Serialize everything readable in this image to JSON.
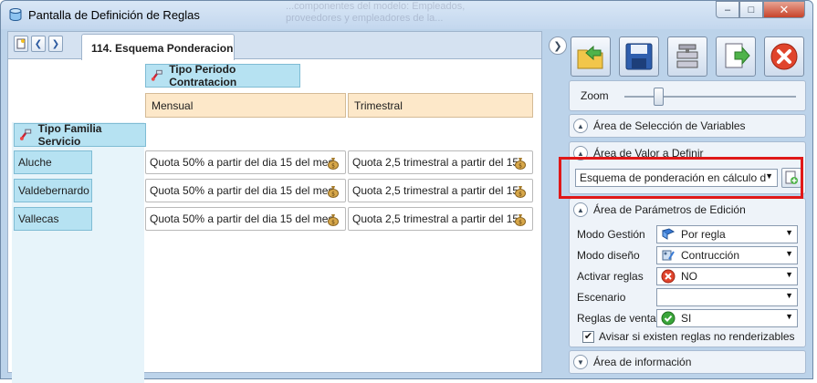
{
  "window": {
    "title": "Pantalla de Definición de Reglas",
    "ghost_text": "...componentes del modelo: Empleados, proveedores y empleadores de la...",
    "buttons": {
      "minimize": "‒",
      "maximize": "□",
      "close": "✕"
    }
  },
  "tabs": [
    {
      "label": "114. Esquema Ponderacion",
      "active": true
    }
  ],
  "pivot": {
    "column_header": "Tipo Periodo Contratacion",
    "row_header": "Tipo Familia Servicio",
    "columns": [
      "Mensual",
      "Trimestral"
    ],
    "rows": [
      {
        "label": "Aluche",
        "cells": [
          "Quota 50% a partir del dia 15 del mes",
          "Quota 2,5 trimestral a partir del 15"
        ]
      },
      {
        "label": "Valdebernardo",
        "cells": [
          "Quota 50% a partir del dia 15 del mes",
          "Quota 2,5 trimestral a partir del 15"
        ]
      },
      {
        "label": "Vallecas",
        "cells": [
          "Quota 50% a partir del dia 15 del mes",
          "Quota 2,5 trimestral a partir del 15"
        ]
      }
    ]
  },
  "right_panel": {
    "zoom_label": "Zoom",
    "zoom_level": 0.18,
    "sections": {
      "variables": "Área de Selección de Variables",
      "valor": "Área de Valor a Definir",
      "parametros": "Área de Parámetros de Edición",
      "info": "Área de información"
    },
    "valor_combo": "Esquema de ponderación en cálculo d",
    "params": [
      {
        "label": "Modo Gestión",
        "value": "Por regla",
        "icon": "book-icon"
      },
      {
        "label": "Modo diseño",
        "value": "Contrucción",
        "icon": "design-icon"
      },
      {
        "label": "Activar reglas",
        "value": "NO",
        "icon": "red-x-icon"
      },
      {
        "label": "Escenario",
        "value": "",
        "icon": ""
      },
      {
        "label": "Reglas de venta",
        "value": "SI",
        "icon": "green-check-icon"
      }
    ],
    "checkbox_label": "Avisar si existen reglas no renderizables",
    "checkbox_checked": true
  },
  "colors": {
    "accent_header": "#b6e2f2",
    "column_value": "#fde8c9",
    "highlight_box": "#e01818"
  }
}
